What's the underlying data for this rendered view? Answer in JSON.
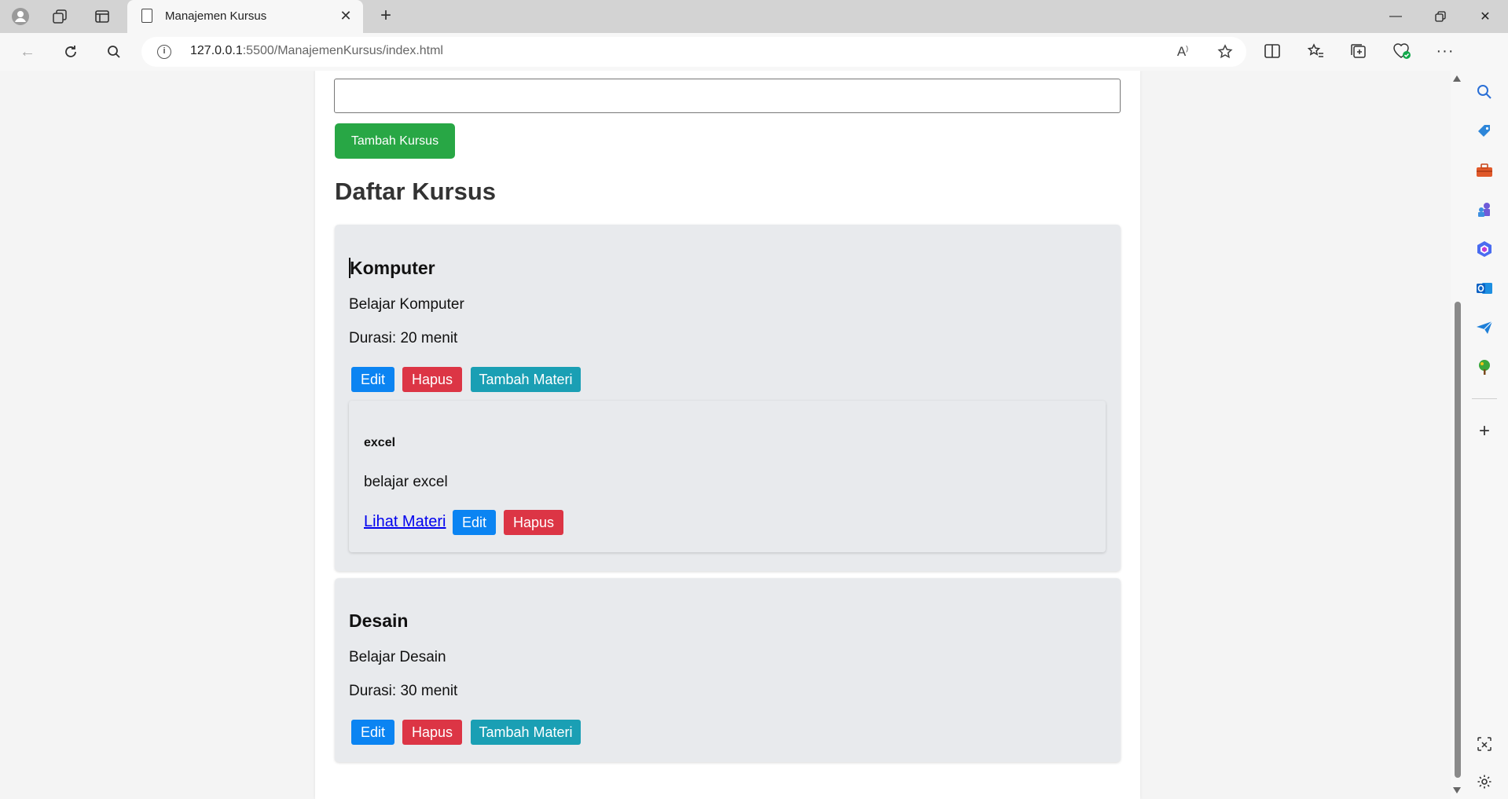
{
  "browser": {
    "tab_title": "Manajemen Kursus",
    "url_host": "127.0.0.1",
    "url_rest": ":5500/ManajemenKursus/index.html"
  },
  "form": {
    "course_name_value": "",
    "add_course_label": "Tambah Kursus"
  },
  "list_heading": "Daftar Kursus",
  "courses": [
    {
      "title": "Komputer",
      "description": "Belajar Komputer",
      "duration": "Durasi: 20 menit",
      "edit_label": "Edit",
      "delete_label": "Hapus",
      "add_material_label": "Tambah Materi",
      "materials": [
        {
          "title": "excel",
          "description": "belajar excel",
          "view_label": "Lihat Materi",
          "edit_label": "Edit",
          "delete_label": "Hapus"
        }
      ]
    },
    {
      "title": "Desain",
      "description": "Belajar Desain",
      "duration": "Durasi: 30 menit",
      "edit_label": "Edit",
      "delete_label": "Hapus",
      "add_material_label": "Tambah Materi",
      "materials": []
    }
  ],
  "colors": {
    "success": "#28a745",
    "primary": "#0b84f2",
    "danger": "#dc3545",
    "info": "#1a9fb4"
  }
}
